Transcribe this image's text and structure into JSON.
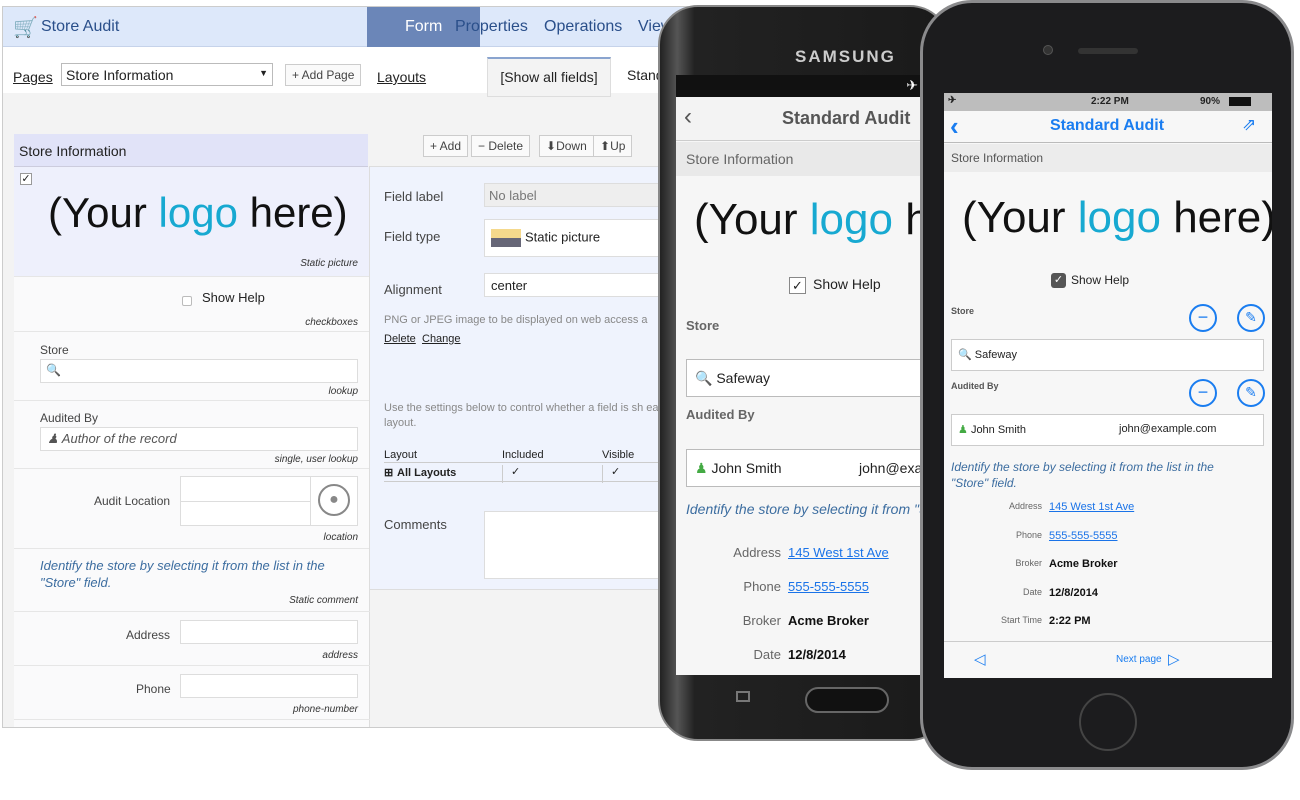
{
  "app": {
    "title": "Store Audit",
    "icon": "shopping-cart-icon"
  },
  "tabs": [
    {
      "label": "Form",
      "active": true
    },
    {
      "label": "Properties"
    },
    {
      "label": "Operations"
    },
    {
      "label": "View"
    }
  ],
  "pages": {
    "label": "Pages",
    "selected": "Store Information",
    "add_label": "+ Add Page"
  },
  "layouts": {
    "label": "Layouts",
    "tabs": [
      "[Show all fields]",
      "Stand"
    ]
  },
  "toolbar": {
    "add": "+ Add",
    "delete": "− Delete",
    "down": "Down",
    "up": "Up"
  },
  "section": {
    "title": "Store Information"
  },
  "form": {
    "logo": {
      "pre": "(Your ",
      "accent": "logo",
      "post": " here)",
      "hint": "Static picture"
    },
    "show_help": {
      "label": "Show Help",
      "hint": "checkboxes",
      "checked": false
    },
    "store": {
      "label": "Store",
      "hint": "lookup"
    },
    "audited_by": {
      "label": "Audited By",
      "placeholder": "Author of the record",
      "hint": "single, user lookup"
    },
    "audit_location": {
      "label": "Audit Location",
      "hint": "location"
    },
    "comment": {
      "text": "Identify the store by selecting it from the list in the \"Store\" field.",
      "hint": "Static comment"
    },
    "address": {
      "label": "Address",
      "hint": "address"
    },
    "phone": {
      "label": "Phone",
      "hint": "phone-number"
    }
  },
  "props": {
    "field_label": {
      "label": "Field label",
      "placeholder": "No label"
    },
    "field_type": {
      "label": "Field type",
      "value": "Static picture"
    },
    "alignment": {
      "label": "Alignment",
      "value": "center"
    },
    "description": "PNG or JPEG image to be displayed on web access a",
    "delete": "Delete",
    "change": "Change",
    "layout_help": "Use the settings below to control whether a field is sh each layout.",
    "table": {
      "headers": [
        "Layout",
        "Included",
        "Visible"
      ],
      "row": {
        "name": "All Layouts",
        "included": true,
        "visible": true
      }
    },
    "comments": {
      "label": "Comments"
    }
  },
  "samsung": {
    "brand": "SAMSUNG",
    "title": "Standard Audit",
    "section": "Store Information",
    "show_help": "Show Help",
    "store_label": "Store",
    "store_value": "Safeway",
    "audited_label": "Audited By",
    "user": "John Smith",
    "email": "john@exar",
    "help": "Identify the store by selecting it from \"Store\" field.",
    "fields": [
      {
        "label": "Address",
        "value": "145 West 1st Ave",
        "link": true
      },
      {
        "label": "Phone",
        "value": "555-555-5555",
        "link": true
      },
      {
        "label": "Broker",
        "value": "Acme Broker"
      },
      {
        "label": "Date",
        "value": "12/8/2014"
      }
    ]
  },
  "iphone": {
    "time": "2:22 PM",
    "battery": "90%",
    "title": "Standard Audit",
    "section": "Store Information",
    "show_help": "Show Help",
    "store_label": "Store",
    "store_value": "Safeway",
    "audited_label": "Audited By",
    "user": "John Smith",
    "email": "john@example.com",
    "help": "Identify the store by selecting it from the list in the \"Store\" field.",
    "fields": [
      {
        "label": "Address",
        "value": "145 West 1st Ave",
        "link": true
      },
      {
        "label": "Phone",
        "value": "555-555-5555",
        "link": true
      },
      {
        "label": "Broker",
        "value": "Acme Broker"
      },
      {
        "label": "Date",
        "value": "12/8/2014"
      },
      {
        "label": "Start Time",
        "value": "2:22 PM"
      }
    ],
    "next_page": "Next page"
  },
  "colors": {
    "accent": "#6b86b8",
    "ios_blue": "#1a7df0",
    "logo_blue": "#17a9d1"
  }
}
